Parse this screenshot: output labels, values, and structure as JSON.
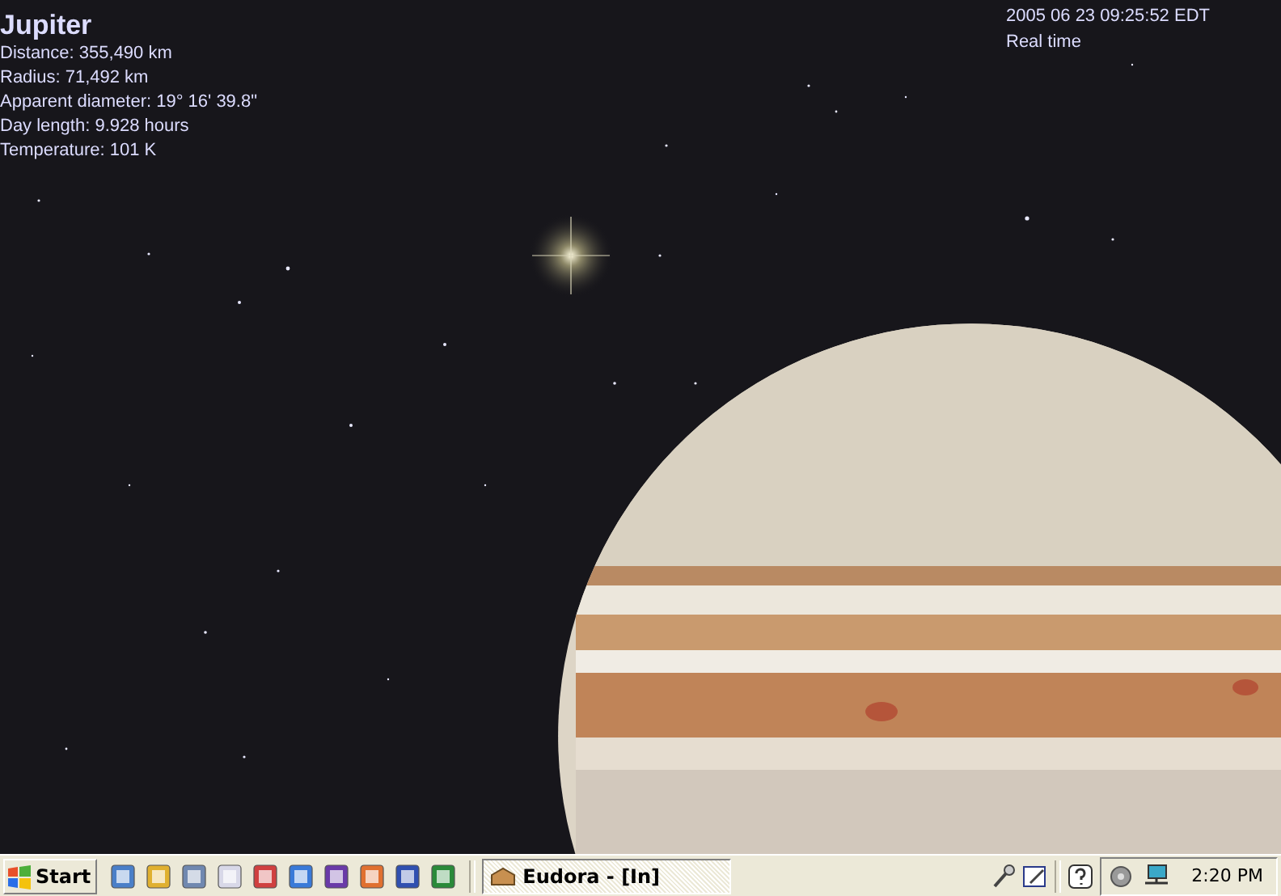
{
  "object_info": {
    "title": "Jupiter",
    "lines": [
      "Distance: 355,490 km",
      "Radius: 71,492 km",
      "Apparent diameter: 19° 16' 39.8\"",
      "Day length: 9.928 hours",
      "Temperature: 101 K"
    ]
  },
  "time_info": {
    "datetime": "2005 06 23 09:25:52 EDT",
    "mode": "Real time"
  },
  "taskbar": {
    "start_label": "Start",
    "tasks": [
      {
        "label": "Eudora - [In]",
        "selected": true
      }
    ],
    "clock": "2:20 PM"
  }
}
